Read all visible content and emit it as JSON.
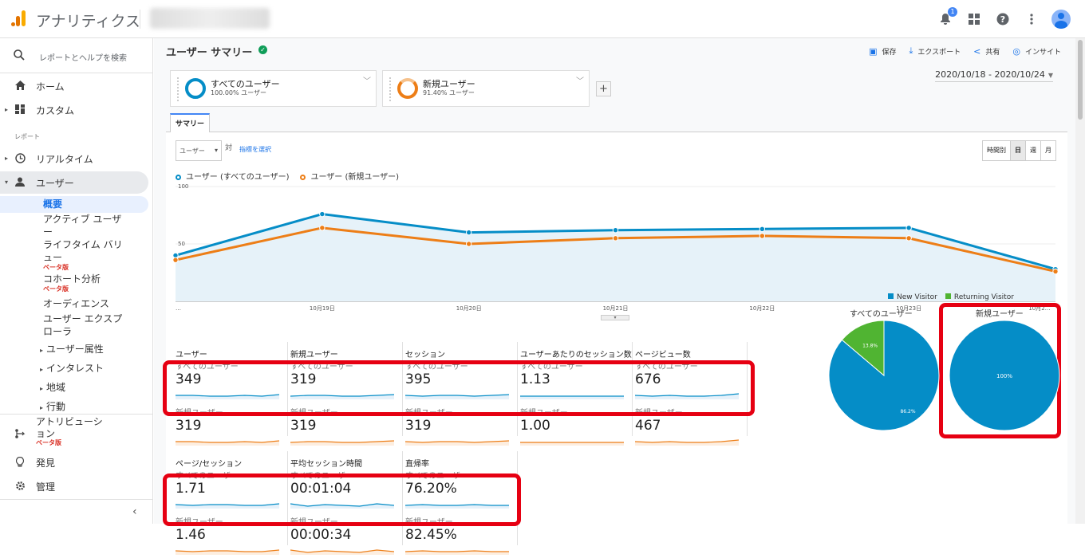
{
  "app": {
    "title": "アナリティクス",
    "notification_count": "1"
  },
  "sidebar": {
    "search_label": "レポートとヘルプを検索",
    "home": "ホーム",
    "custom": "カスタム",
    "section_reports": "レポート",
    "realtime": "リアルタイム",
    "users": "ユーザー",
    "sub_items": {
      "overview": "概要",
      "active_users": "アクティブ ユーザー",
      "lifetime_value": "ライフタイム バリュー",
      "cohort": "コホート分析",
      "audiences": "オーディエンス",
      "user_explorer": "ユーザー エクスプローラ",
      "beta_label": "ベータ版"
    },
    "sub2": [
      "ユーザー属性",
      "インタレスト",
      "地域",
      "行動"
    ],
    "attribution": "アトリビューション",
    "discover": "発見",
    "admin": "管理"
  },
  "header": {
    "page_title": "ユーザー サマリー",
    "actions": {
      "save": "保存",
      "export": "エクスポート",
      "share": "共有",
      "insights": "インサイト"
    }
  },
  "segments": [
    {
      "name": "すべてのユーザー",
      "pct": "100.00% ユーザー",
      "color": "#058dc7"
    },
    {
      "name": "新規ユーザー",
      "pct": "91.40% ユーザー",
      "color": "#ed7e17"
    }
  ],
  "date_range": "2020/10/18 - 2020/10/24",
  "tab": "サマリー",
  "controls": {
    "metric_select": "ユーザー",
    "vs": "対",
    "pick_metric": "指標を選択",
    "period": [
      "時間別",
      "日",
      "週",
      "月"
    ],
    "period_selected": "日"
  },
  "chart_data": {
    "type": "line",
    "x": [
      "…",
      "10月19日",
      "10月20日",
      "10月21日",
      "10月22日",
      "10月23日",
      "10月2…"
    ],
    "yticks": [
      "100",
      "50"
    ],
    "ylim": [
      0,
      100
    ],
    "series": [
      {
        "name": "ユーザー (すべてのユーザー)",
        "color": "#058dc7",
        "values": [
          40,
          76,
          60,
          62,
          63,
          64,
          28
        ]
      },
      {
        "name": "ユーザー (新規ユーザー)",
        "color": "#ed7e17",
        "values": [
          36,
          64,
          50,
          55,
          57,
          55,
          26
        ]
      }
    ]
  },
  "metrics_row1": [
    {
      "title": "ユーザー",
      "all_label": "すべてのユーザー",
      "all_value": "349",
      "new_label": "新規ユーザー",
      "new_value": "319"
    },
    {
      "title": "新規ユーザー",
      "all_label": "すべてのユーザー",
      "all_value": "319",
      "new_label": "新規ユーザー",
      "new_value": "319"
    },
    {
      "title": "セッション",
      "all_label": "すべてのユーザー",
      "all_value": "395",
      "new_label": "新規ユーザー",
      "new_value": "319"
    },
    {
      "title": "ユーザーあたりのセッション数",
      "all_label": "すべてのユーザー",
      "all_value": "1.13",
      "new_label": "新規ユーザー",
      "new_value": "1.00"
    },
    {
      "title": "ページビュー数",
      "all_label": "すべてのユーザー",
      "all_value": "676",
      "new_label": "新規ユーザー",
      "new_value": "467"
    }
  ],
  "metrics_row2": [
    {
      "title": "ページ/セッション",
      "all_label": "すべてのユーザー",
      "all_value": "1.71",
      "new_label": "新規ユーザー",
      "new_value": "1.46"
    },
    {
      "title": "平均セッション時間",
      "all_label": "すべてのユーザー",
      "all_value": "00:01:04",
      "new_label": "新規ユーザー",
      "new_value": "00:00:34"
    },
    {
      "title": "直帰率",
      "all_label": "すべてのユーザー",
      "all_value": "76.20%",
      "new_label": "新規ユーザー",
      "new_value": "82.45%"
    }
  ],
  "pies": {
    "legend": [
      {
        "name": "New Visitor",
        "color": "#058dc7"
      },
      {
        "name": "Returning Visitor",
        "color": "#50b432"
      }
    ],
    "charts": [
      {
        "title": "すべてのユーザー",
        "new": 86.2,
        "returning": 13.8,
        "new_label": "86.2%",
        "ret_label": "13.8%"
      },
      {
        "title": "新規ユーザー",
        "new": 100,
        "returning": 0,
        "new_label": "100%",
        "ret_label": ""
      }
    ]
  }
}
